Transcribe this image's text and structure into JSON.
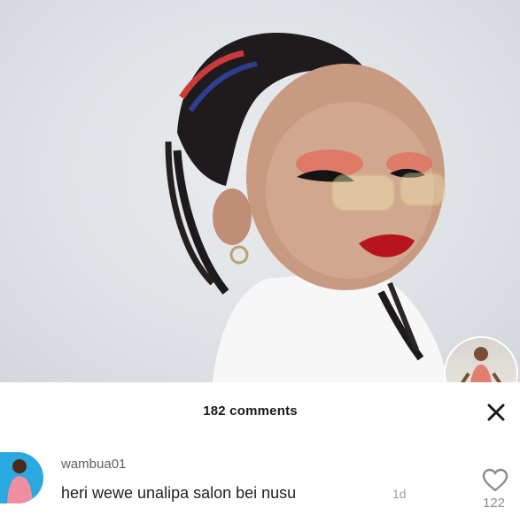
{
  "comments_panel": {
    "count_label": "182 comments",
    "close_icon": "close-icon"
  },
  "comment": {
    "username": "wambua01",
    "text": "heri wewe unalipa salon bei nusu",
    "time": "1d",
    "likes": "122",
    "like_icon": "heart-outline-icon"
  },
  "colors": {
    "text_primary": "#161823",
    "text_secondary": "#8a8d92",
    "avatar_bg": "#2aa8e0"
  }
}
